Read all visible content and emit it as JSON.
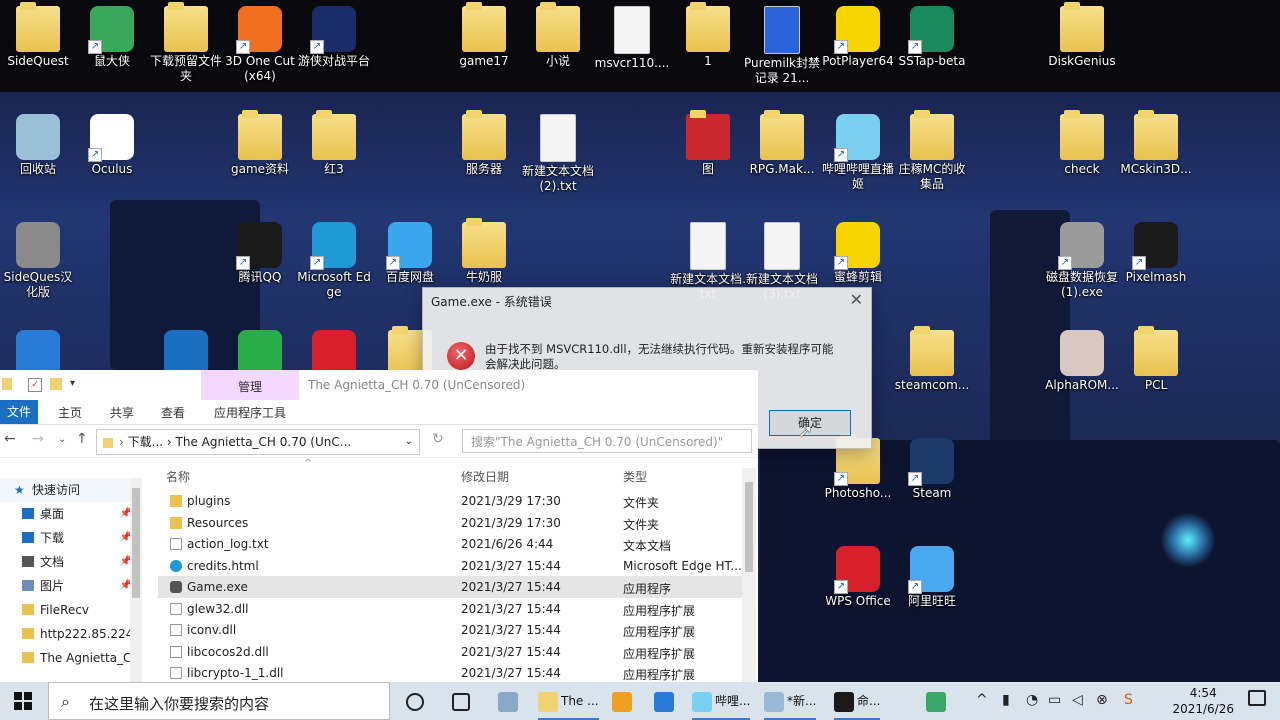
{
  "desktop": {
    "icons": [
      {
        "label": "SideQuest",
        "kind": "folder",
        "color": "#e9c24f",
        "shortcut": false
      },
      {
        "label": "鼠大侠",
        "kind": "app",
        "color": "#3aa85a",
        "shortcut": true
      },
      {
        "label": "下载预留文件夹",
        "kind": "folder",
        "color": "#e9c24f",
        "shortcut": false
      },
      {
        "label": "3D One Cut(x64)",
        "kind": "app",
        "color": "#f07020",
        "shortcut": true
      },
      {
        "label": "游侠对战平台",
        "kind": "app",
        "color": "#1b2c6a",
        "shortcut": true
      },
      {
        "label": "game17",
        "kind": "folder",
        "color": "#e9c24f",
        "shortcut": false
      },
      {
        "label": "小说",
        "kind": "folder",
        "color": "#e9c24f",
        "shortcut": false
      },
      {
        "label": "msvcr110....",
        "kind": "doc",
        "color": "#f4f4f4",
        "shortcut": false
      },
      {
        "label": "1",
        "kind": "folder",
        "color": "#e9c24f",
        "shortcut": false
      },
      {
        "label": "Puremilk封禁记录 21...",
        "kind": "doc",
        "color": "#2b63d9",
        "shortcut": false
      },
      {
        "label": "PotPlayer64",
        "kind": "app",
        "color": "#f6d400",
        "shortcut": true
      },
      {
        "label": "SSTap-beta",
        "kind": "app",
        "color": "#1a8a5c",
        "shortcut": true
      },
      {
        "label": "DiskGenius",
        "kind": "folder",
        "color": "#e9c24f",
        "shortcut": false
      },
      {
        "label": "回收站",
        "kind": "app",
        "color": "#9ac0d8",
        "shortcut": false
      },
      {
        "label": "Oculus",
        "kind": "app",
        "color": "#ffffff",
        "shortcut": true
      },
      {
        "label": "game资料",
        "kind": "folder",
        "color": "#e9c24f",
        "shortcut": false
      },
      {
        "label": "红3",
        "kind": "folder",
        "color": "#e9c24f",
        "shortcut": false
      },
      {
        "label": "服务器",
        "kind": "folder",
        "color": "#e9c24f",
        "shortcut": false
      },
      {
        "label": "新建文本文档 (2).txt",
        "kind": "doc",
        "color": "#f4f4f4",
        "shortcut": false
      },
      {
        "label": "图",
        "kind": "folder",
        "color": "#c8282e",
        "shortcut": false
      },
      {
        "label": "RPG.Mak...",
        "kind": "folder",
        "color": "#e9c24f",
        "shortcut": false
      },
      {
        "label": "哔哩哔哩直播姬",
        "kind": "app",
        "color": "#7ad0f0",
        "shortcut": true
      },
      {
        "label": "庄稼MC的收集品",
        "kind": "folder",
        "color": "#e9c24f",
        "shortcut": false
      },
      {
        "label": "check",
        "kind": "folder",
        "color": "#e9c24f",
        "shortcut": false
      },
      {
        "label": "MCskin3D...",
        "kind": "folder",
        "color": "#e9c24f",
        "shortcut": false
      },
      {
        "label": "SideQues汉化版",
        "kind": "app",
        "color": "#8a8a8a",
        "shortcut": false
      },
      {
        "label": "腾讯QQ",
        "kind": "app",
        "color": "#1a1a1a",
        "shortcut": true
      },
      {
        "label": "Microsoft Edge",
        "kind": "app",
        "color": "#1f9ad6",
        "shortcut": true
      },
      {
        "label": "百度网盘",
        "kind": "app",
        "color": "#3aa6f0",
        "shortcut": true
      },
      {
        "label": "牛奶服",
        "kind": "folder",
        "color": "#e9c24f",
        "shortcut": false
      },
      {
        "label": "新建文本文档.txt",
        "kind": "doc",
        "color": "#f4f4f4",
        "shortcut": false
      },
      {
        "label": "新建文本文档 (3).txt",
        "kind": "doc",
        "color": "#f4f4f4",
        "shortcut": false
      },
      {
        "label": "蜜蜂剪辑",
        "kind": "app",
        "color": "#f6d400",
        "shortcut": true
      },
      {
        "label": "磁盘数据恢复 (1).exe",
        "kind": "app",
        "color": "#9a9a9a",
        "shortcut": true
      },
      {
        "label": "Pixelmash",
        "kind": "app",
        "color": "#1a1a1a",
        "shortcut": true
      },
      {
        "label": "",
        "kind": "app",
        "color": "#2a7ad8",
        "shortcut": false
      },
      {
        "label": "",
        "kind": "app",
        "color": "#1a6fc2",
        "shortcut": false
      },
      {
        "label": "",
        "kind": "app",
        "color": "#2aad48",
        "shortcut": false
      },
      {
        "label": "",
        "kind": "app",
        "color": "#d8202a",
        "shortcut": false
      },
      {
        "label": "",
        "kind": "folder",
        "color": "#e9c24f",
        "shortcut": false
      },
      {
        "label": "steamcom...",
        "kind": "folder",
        "color": "#e9c24f",
        "shortcut": false
      },
      {
        "label": "AlphaROM...",
        "kind": "app",
        "color": "#d8c8c0",
        "shortcut": false
      },
      {
        "label": "PCL",
        "kind": "folder",
        "color": "#e9c24f",
        "shortcut": false
      },
      {
        "label": "Photosho...",
        "kind": "folder",
        "color": "#e9c24f",
        "shortcut": true
      },
      {
        "label": "Steam",
        "kind": "app",
        "color": "#1b3a6a",
        "shortcut": true
      },
      {
        "label": "WPS Office",
        "kind": "app",
        "color": "#d8202a",
        "shortcut": true
      },
      {
        "label": "阿里旺旺",
        "kind": "app",
        "color": "#4aa8f0",
        "shortcut": true
      }
    ]
  },
  "dialog": {
    "title": "Game.exe - 系统错误",
    "close": "✕",
    "error_icon": "✕",
    "message": "由于找不到 MSVCR110.dll，无法继续执行代码。重新安装程序可能会解决此问题。",
    "ok_label": "确定"
  },
  "explorer": {
    "ribbon_context_tab": "管理",
    "window_title": "The Agnietta_CH 0.70 (UnCensored)",
    "ribbon_tabs": [
      "文件",
      "主页",
      "共享",
      "查看",
      "应用程序工具"
    ],
    "address": "下载...  ›  The Agnietta_CH 0.70 (UnC...",
    "search_placeholder": "搜索\"The Agnietta_CH 0.70 (UnCensored)\"",
    "nav_items": [
      {
        "label": "快速访问",
        "icon": "star-icon",
        "pinned": false
      },
      {
        "label": "桌面",
        "icon": "desktop-icon",
        "pinned": true
      },
      {
        "label": "下载",
        "icon": "download-icon",
        "pinned": true
      },
      {
        "label": "文档",
        "icon": "document-icon",
        "pinned": true
      },
      {
        "label": "图片",
        "icon": "picture-icon",
        "pinned": true
      },
      {
        "label": "FileRecv",
        "icon": "folder-icon",
        "pinned": false
      },
      {
        "label": "http222.85.224",
        "icon": "folder-icon",
        "pinned": false
      },
      {
        "label": "The Agnietta_C",
        "icon": "folder-icon",
        "pinned": false
      }
    ],
    "columns": {
      "name": "名称",
      "date": "修改日期",
      "type": "类型"
    },
    "files": [
      {
        "name": "plugins",
        "date": "2021/3/29 17:30",
        "type": "文件夹",
        "icon": "folder"
      },
      {
        "name": "Resources",
        "date": "2021/3/29 17:30",
        "type": "文件夹",
        "icon": "folder"
      },
      {
        "name": "action_log.txt",
        "date": "2021/6/26 4:44",
        "type": "文本文档",
        "icon": "text"
      },
      {
        "name": "credits.html",
        "date": "2021/3/27 15:44",
        "type": "Microsoft Edge HT...",
        "icon": "edge"
      },
      {
        "name": "Game.exe",
        "date": "2021/3/27 15:44",
        "type": "应用程序",
        "icon": "exe"
      },
      {
        "name": "glew32.dll",
        "date": "2021/3/27 15:44",
        "type": "应用程序扩展",
        "icon": "dll"
      },
      {
        "name": "iconv.dll",
        "date": "2021/3/27 15:44",
        "type": "应用程序扩展",
        "icon": "dll"
      },
      {
        "name": "libcocos2d.dll",
        "date": "2021/3/27 15:44",
        "type": "应用程序扩展",
        "icon": "dll"
      },
      {
        "name": "libcrypto-1_1.dll",
        "date": "2021/3/27 15:44",
        "type": "应用程序扩展",
        "icon": "dll"
      }
    ],
    "selected_file": "Game.exe"
  },
  "taskbar": {
    "search_placeholder": "在这里输入你要搜索的内容",
    "apps": [
      {
        "label": "",
        "icon": "cortana-icon"
      },
      {
        "label": "",
        "icon": "task-view-icon"
      },
      {
        "label": "",
        "icon": "photos-icon"
      },
      {
        "label": "The ...",
        "icon": "file-explorer-icon"
      },
      {
        "label": "",
        "icon": "shield-icon"
      },
      {
        "label": "",
        "icon": "baidu-icon"
      },
      {
        "label": "哔哩...",
        "icon": "bilibili-icon"
      },
      {
        "label": "*新...",
        "icon": "notepad-icon"
      },
      {
        "label": "命...",
        "icon": "cmd-icon"
      },
      {
        "label": "",
        "icon": "app-icon"
      }
    ],
    "time": "4:54",
    "date": "2021/6/26"
  }
}
